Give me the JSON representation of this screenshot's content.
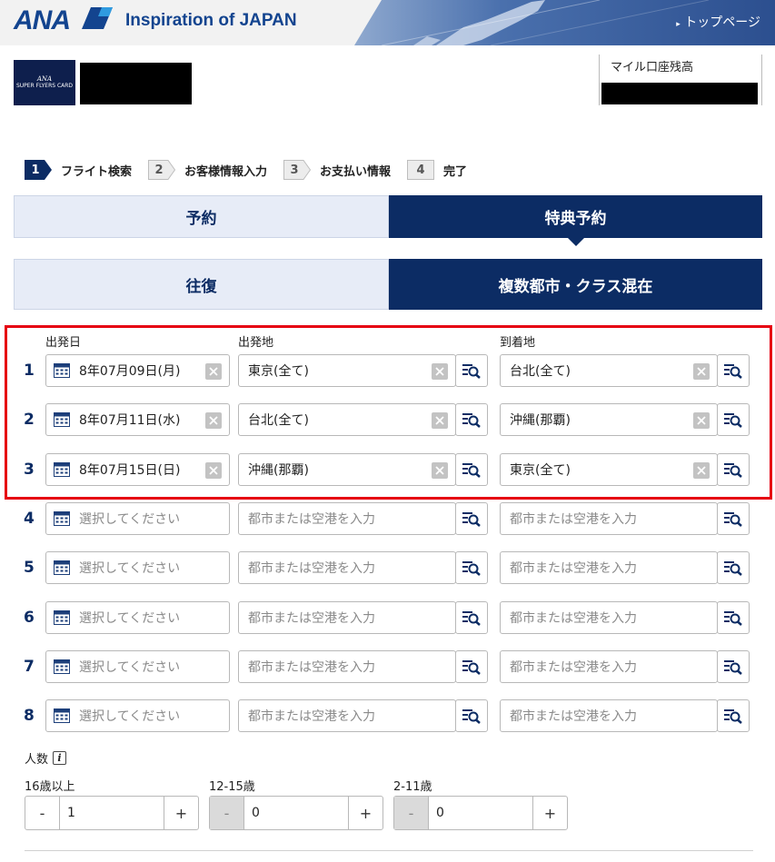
{
  "header": {
    "logo": "ANA",
    "tagline": "Inspiration of JAPAN",
    "top_link": "トップページ"
  },
  "member": {
    "card_line1": "ANA",
    "card_line2": "SUPER FLYERS CARD",
    "mile_label": "マイル口座残高"
  },
  "steps": [
    {
      "num": "1",
      "label": "フライト検索"
    },
    {
      "num": "2",
      "label": "お客様情報入力"
    },
    {
      "num": "3",
      "label": "お支払い情報"
    },
    {
      "num": "4",
      "label": "完了"
    }
  ],
  "booking_tabs": {
    "reserve": "予約",
    "award": "特典予約"
  },
  "trip_tabs": {
    "roundtrip": "往復",
    "multi": "複数都市・クラス混在"
  },
  "columns": {
    "date": "出発日",
    "departure": "出発地",
    "arrival": "到着地"
  },
  "placeholders": {
    "date": "選択してください",
    "city": "都市または空港を入力"
  },
  "rows": [
    {
      "num": "1",
      "date": "8年07月09日(月)",
      "from": "東京(全て)",
      "to": "台北(全て)"
    },
    {
      "num": "2",
      "date": "8年07月11日(水)",
      "from": "台北(全て)",
      "to": "沖縄(那覇)"
    },
    {
      "num": "3",
      "date": "8年07月15日(日)",
      "from": "沖縄(那覇)",
      "to": "東京(全て)"
    },
    {
      "num": "4",
      "date": "",
      "from": "",
      "to": ""
    },
    {
      "num": "5",
      "date": "",
      "from": "",
      "to": ""
    },
    {
      "num": "6",
      "date": "",
      "from": "",
      "to": ""
    },
    {
      "num": "7",
      "date": "",
      "from": "",
      "to": ""
    },
    {
      "num": "8",
      "date": "",
      "from": "",
      "to": ""
    }
  ],
  "passengers": {
    "title": "人数",
    "groups": [
      {
        "label": "16歳以上",
        "value": "1",
        "minus": "-",
        "plus": "+"
      },
      {
        "label": "12-15歳",
        "value": "0",
        "minus": "-",
        "plus": "+"
      },
      {
        "label": "2-11歳",
        "value": "0",
        "minus": "-",
        "plus": "+"
      }
    ]
  },
  "colors": {
    "navy": "#0c2c64",
    "light_tab": "#e7ecf7",
    "highlight": "#e60012"
  }
}
